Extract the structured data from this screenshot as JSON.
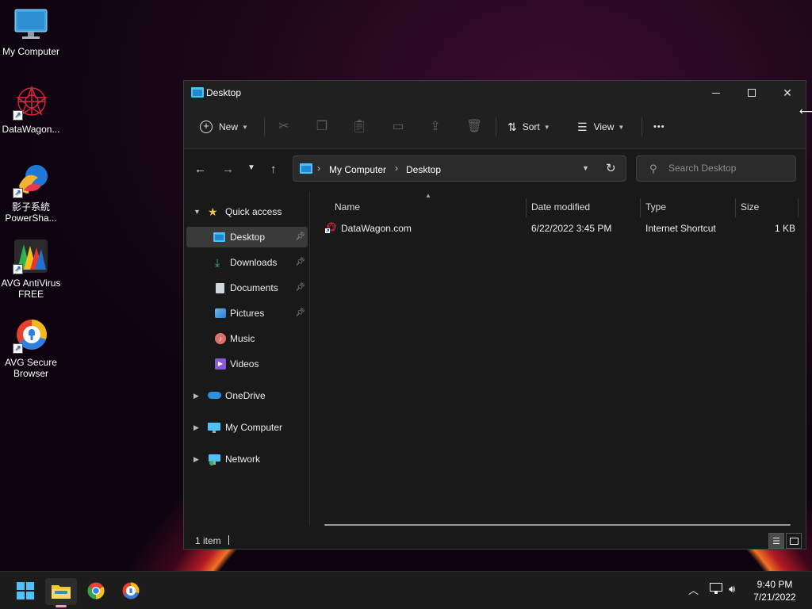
{
  "desktop": {
    "icons": [
      {
        "label": "My Computer"
      },
      {
        "label": "DataWagon..."
      },
      {
        "label": "影子系統 PowerSha..."
      },
      {
        "label": "AVG AntiVirus FREE"
      },
      {
        "label": "AVG Secure Browser"
      }
    ]
  },
  "window": {
    "title": "Desktop",
    "controls": {
      "minimize": "—",
      "maximize": "☐",
      "close": "✕"
    }
  },
  "toolbar": {
    "new_label": "New",
    "sort_label": "Sort",
    "view_label": "View",
    "more_label": "•••"
  },
  "address": {
    "segments": [
      "My Computer",
      "Desktop"
    ],
    "search_placeholder": "Search Desktop"
  },
  "sidebar": {
    "quick_access": "Quick access",
    "items": [
      {
        "label": "Desktop",
        "icon": "desktop-icon",
        "pinned": true
      },
      {
        "label": "Downloads",
        "icon": "download-icon",
        "pinned": true
      },
      {
        "label": "Documents",
        "icon": "document-icon",
        "pinned": true
      },
      {
        "label": "Pictures",
        "icon": "pictures-icon",
        "pinned": true
      },
      {
        "label": "Music",
        "icon": "music-icon",
        "pinned": false
      },
      {
        "label": "Videos",
        "icon": "videos-icon",
        "pinned": false
      }
    ],
    "roots": [
      {
        "label": "OneDrive"
      },
      {
        "label": "My Computer"
      },
      {
        "label": "Network"
      }
    ]
  },
  "files": {
    "columns": {
      "name": "Name",
      "date": "Date modified",
      "type": "Type",
      "size": "Size"
    },
    "rows": [
      {
        "name": "DataWagon.com",
        "date": "6/22/2022 3:45 PM",
        "type": "Internet Shortcut",
        "size": "1 KB"
      }
    ]
  },
  "status": {
    "count": "1 item"
  },
  "taskbar": {
    "time": "9:40 PM",
    "date": "7/21/2022"
  },
  "colors": {
    "accent": "#4cc2ff",
    "folder": "#f5c242"
  }
}
